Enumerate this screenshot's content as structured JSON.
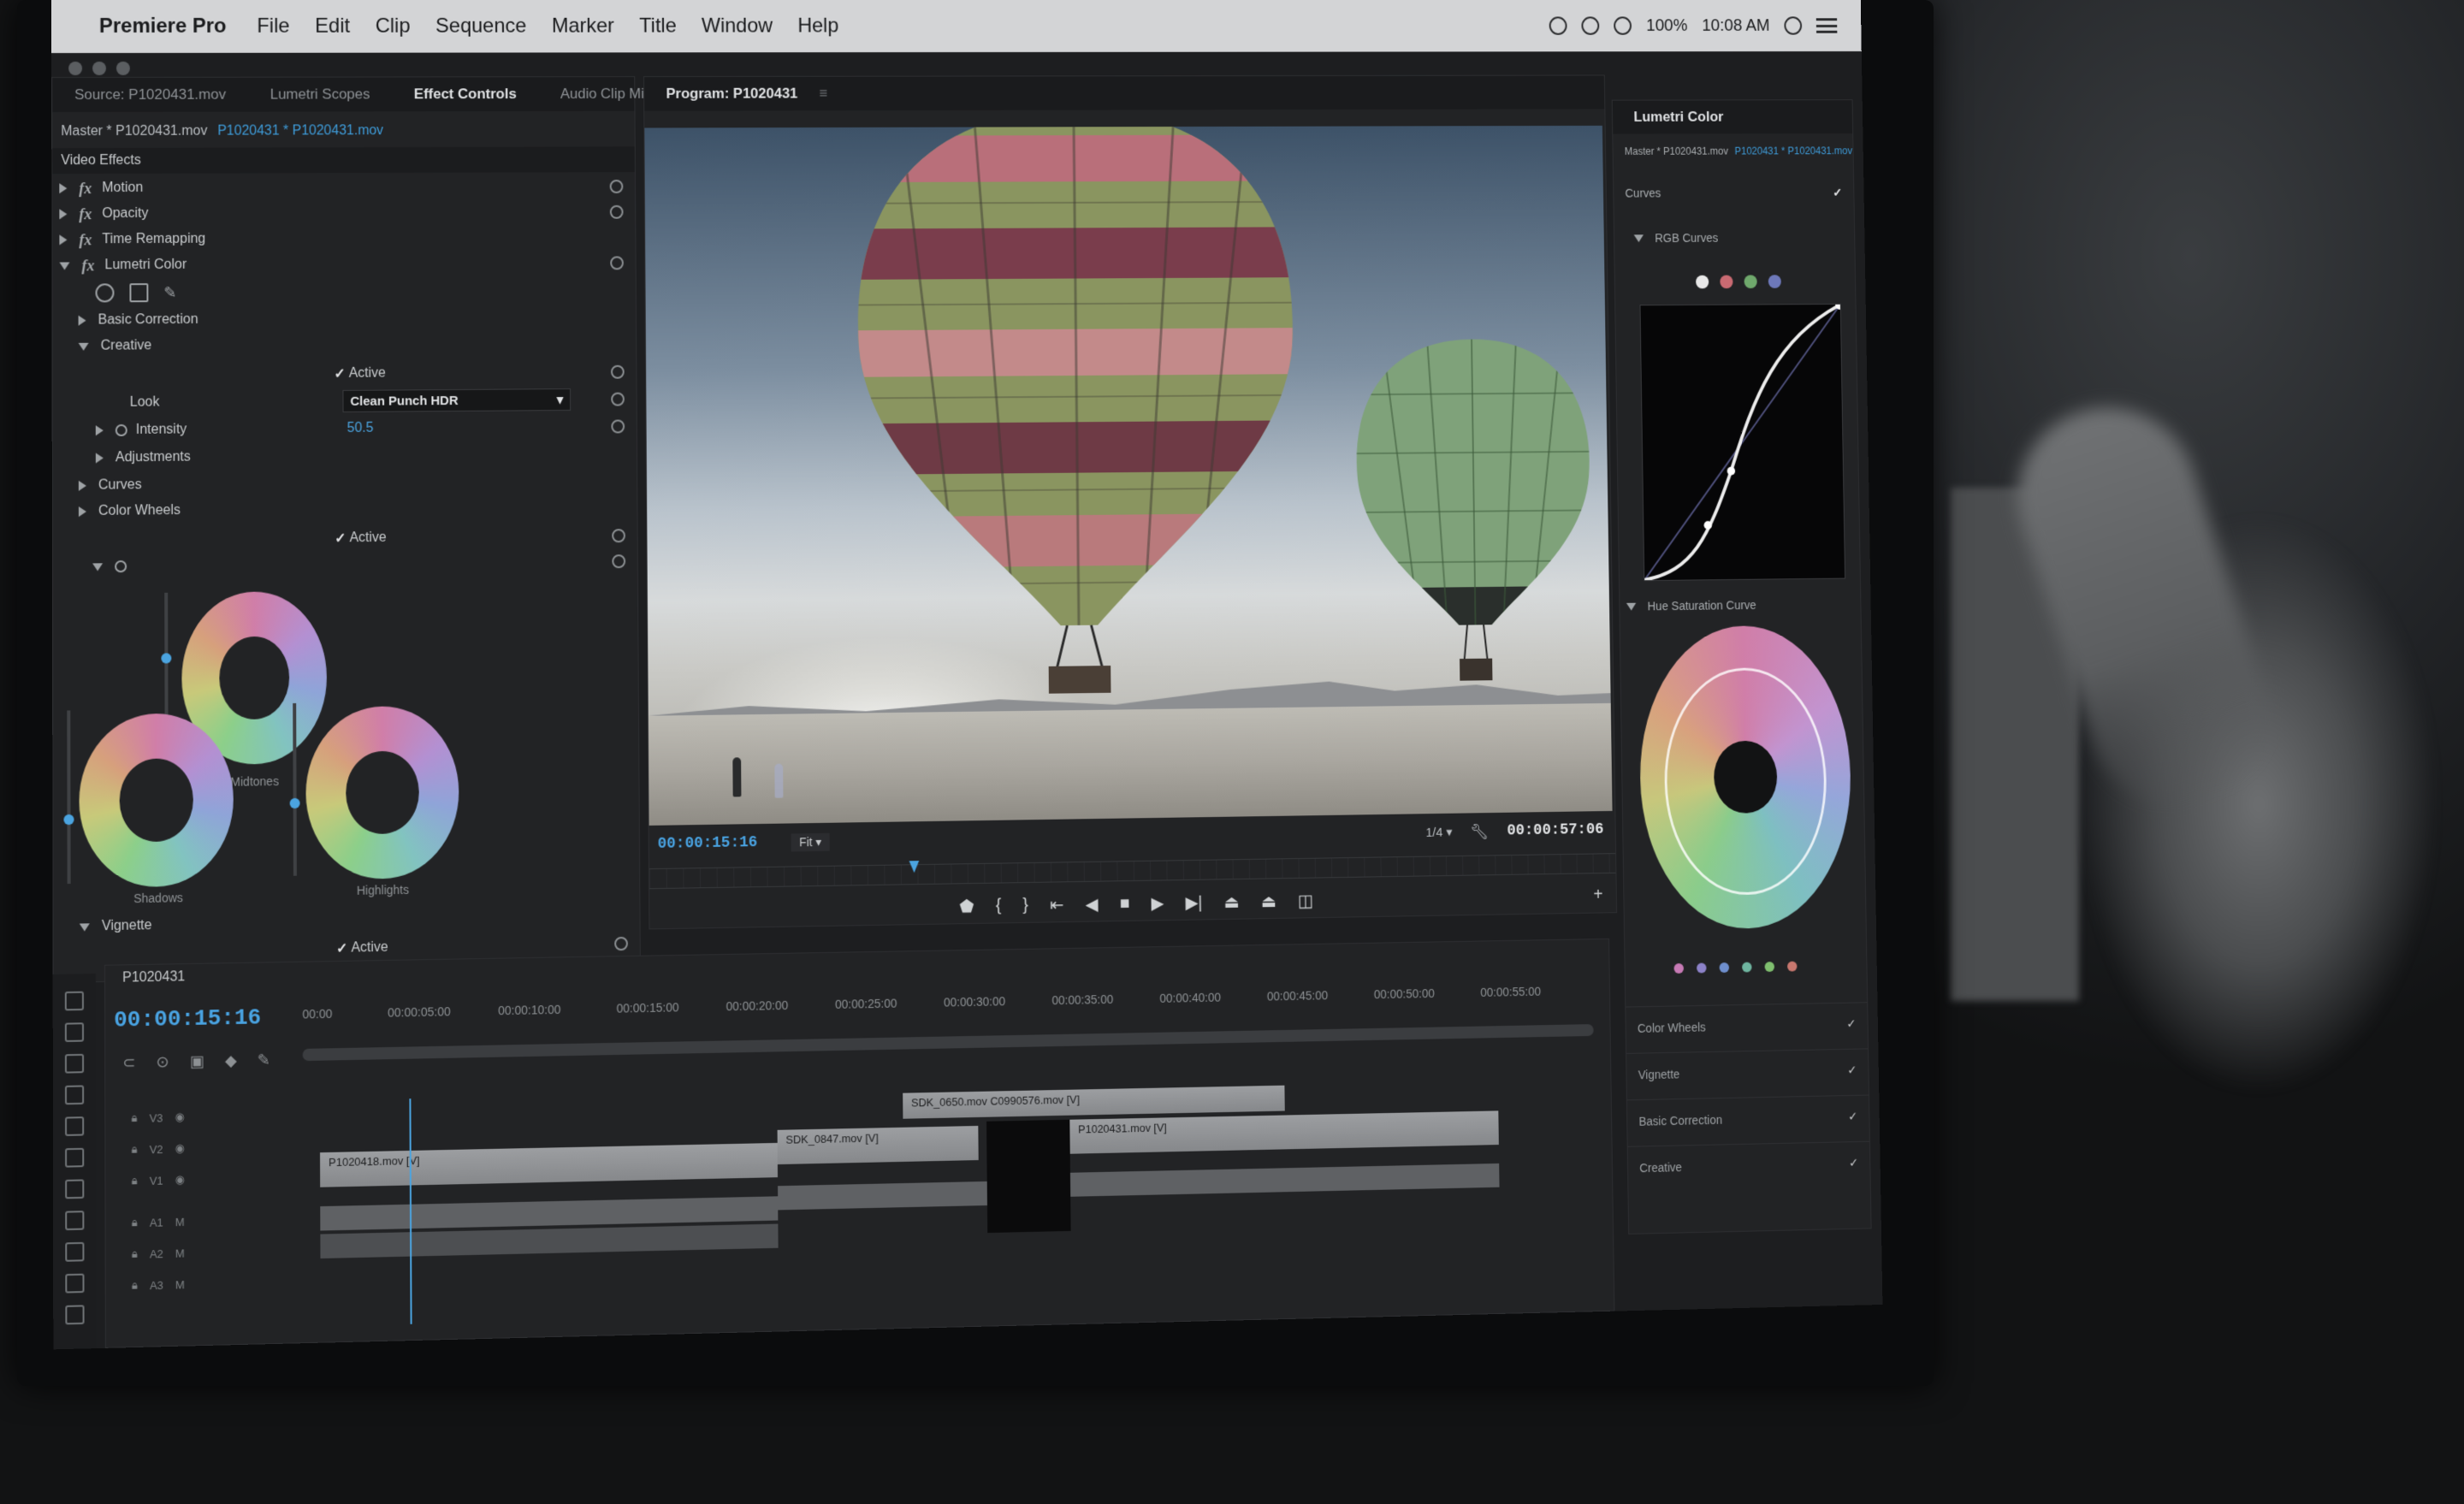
{
  "menubar": {
    "app_name": "Premiere Pro",
    "items": [
      "File",
      "Edit",
      "Clip",
      "Sequence",
      "Marker",
      "Title",
      "Window",
      "Help"
    ],
    "battery": "100%",
    "clock": "10:08 AM"
  },
  "effect_controls": {
    "tabs": [
      {
        "label": "Source: P1020431.mov"
      },
      {
        "label": "Lumetri Scopes"
      },
      {
        "label": "Effect Controls"
      },
      {
        "label": "Audio Clip Mixer: P"
      }
    ],
    "master_label": "Master * P1020431.mov",
    "clip_link": "P1020431 * P1020431.mov",
    "section_title": "Video Effects",
    "effects": [
      {
        "label": "Motion"
      },
      {
        "label": "Opacity"
      },
      {
        "label": "Time Remapping"
      },
      {
        "label": "Lumetri Color"
      }
    ],
    "basic_correction": "Basic Correction",
    "creative": "Creative",
    "active_label": "Active",
    "look_label": "Look",
    "look_value": "Clean Punch HDR",
    "intensity_label": "Intensity",
    "intensity_value": "50.5",
    "adjustments": "Adjustments",
    "curves": "Curves",
    "color_wheels": "Color Wheels",
    "wheels": [
      {
        "label": "Shadows"
      },
      {
        "label": "Midtones"
      },
      {
        "label": "Highlights"
      }
    ],
    "vignette": "Vignette"
  },
  "program_monitor": {
    "tab_label": "Program: P1020431",
    "current_time": "00:00:15:16",
    "fit": "Fit",
    "resolution": "1/4",
    "duration": "00:00:57:06"
  },
  "lumetri": {
    "tab_label": "Lumetri Color",
    "master_label": "Master * P1020431.mov",
    "clip_link": "P1020431 * P1020431.mov",
    "curves_label": "Curves",
    "rgb_curves": "RGB Curves",
    "hue_sat": "Hue Saturation Curve",
    "items": [
      {
        "label": "Color Wheels"
      },
      {
        "label": "Vignette"
      },
      {
        "label": "Basic Correction"
      },
      {
        "label": "Creative"
      }
    ],
    "colors": {
      "white": "#e8e8e8",
      "red": "#c96a72",
      "green": "#6fa86c",
      "blue": "#6d78b9"
    }
  },
  "timeline": {
    "tab_label": "P1020431",
    "timecode": "00:00:15:16",
    "ticks": [
      "00:00",
      "00:00:05:00",
      "00:00:10:00",
      "00:00:15:00",
      "00:00:20:00",
      "00:00:25:00",
      "00:00:30:00",
      "00:00:35:00",
      "00:00:40:00",
      "00:00:45:00",
      "00:00:50:00",
      "00:00:55:00"
    ],
    "tracks": [
      "V3",
      "V2",
      "V1",
      "A1",
      "A2",
      "A3"
    ],
    "clips": {
      "c1": "P1020418.mov [V]",
      "c2": "SDK_0847.mov [V]",
      "c3": "P1020431.mov [V]",
      "c4": "SDK_0650.mov",
      "c5": "C0990576.mov [V]"
    }
  },
  "accent": "#4ba4e0"
}
